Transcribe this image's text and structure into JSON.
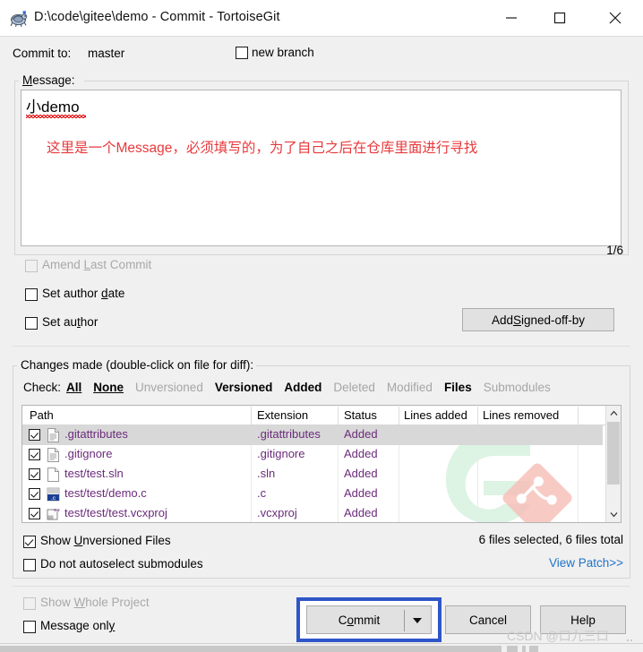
{
  "window": {
    "title": "D:\\code\\gitee\\demo - Commit - TortoiseGit",
    "icon": "tortoisegit-turtle-icon",
    "minimize": "—",
    "maximize": "□",
    "close": "✕"
  },
  "commit_to": {
    "label": "Commit to:",
    "value": "master",
    "new_branch_label": "new branch",
    "new_branch_checked": false
  },
  "message": {
    "group_title": "Message:",
    "line1": "小demo",
    "line2": "这里是一个Message，必须填写的，为了自己之后在仓库里面进行寻找",
    "line1_color": "#000000",
    "line2_color": "#e8393c",
    "counter": "1/6"
  },
  "options_upper": [
    {
      "id": "amend-last-commit",
      "label": "Amend Last Commit",
      "checked": false,
      "disabled": true
    },
    {
      "id": "set-author-date",
      "label": "Set author date",
      "checked": false,
      "disabled": false
    },
    {
      "id": "set-author",
      "label": "Set author",
      "checked": false,
      "disabled": false
    }
  ],
  "add_signed_off_button": "Add Signed-off-by",
  "changes": {
    "group_title": "Changes made (double-click on file for diff):",
    "check_label": "Check:",
    "check_links": [
      {
        "label": "All",
        "state": "link"
      },
      {
        "label": "None",
        "state": "link"
      },
      {
        "label": "Unversioned",
        "state": "off"
      },
      {
        "label": "Versioned",
        "state": "on"
      },
      {
        "label": "Added",
        "state": "on"
      },
      {
        "label": "Deleted",
        "state": "off"
      },
      {
        "label": "Modified",
        "state": "off"
      },
      {
        "label": "Files",
        "state": "on"
      },
      {
        "label": "Submodules",
        "state": "off"
      }
    ],
    "columns": [
      "Path",
      "Extension",
      "Status",
      "Lines added",
      "Lines removed"
    ],
    "rows": [
      {
        "checked": true,
        "icon": "text-file-icon",
        "path": ".gitattributes",
        "extension": ".gitattributes",
        "status": "Added",
        "lines_added": "",
        "lines_removed": "",
        "selected": true
      },
      {
        "checked": true,
        "icon": "text-file-icon",
        "path": ".gitignore",
        "extension": ".gitignore",
        "status": "Added",
        "lines_added": "",
        "lines_removed": "",
        "selected": false
      },
      {
        "checked": true,
        "icon": "blank-file-icon",
        "path": "test/test.sln",
        "extension": ".sln",
        "status": "Added",
        "lines_added": "",
        "lines_removed": "",
        "selected": false
      },
      {
        "checked": true,
        "icon": "c-source-icon",
        "path": "test/test/demo.c",
        "extension": ".c",
        "status": "Added",
        "lines_added": "",
        "lines_removed": "",
        "selected": false
      },
      {
        "checked": true,
        "icon": "vcxproj-icon",
        "path": "test/test/test.vcxproj",
        "extension": ".vcxproj",
        "status": "Added",
        "lines_added": "",
        "lines_removed": "",
        "selected": false
      }
    ],
    "files_total": "6 files selected, 6 files total",
    "view_patch": "View Patch>>"
  },
  "options_lower": [
    {
      "id": "show-unversioned-files",
      "label": "Show Unversioned Files",
      "checked": true,
      "disabled": false
    },
    {
      "id": "do-not-autoselect-submodules",
      "label": "Do not autoselect submodules",
      "checked": false,
      "disabled": false
    },
    {
      "id": "show-whole-project",
      "label": "Show Whole Project",
      "checked": false,
      "disabled": true
    },
    {
      "id": "message-only",
      "label": "Message only",
      "checked": false,
      "disabled": false
    }
  ],
  "buttons": {
    "commit": "Commit",
    "commit_has_dropdown": true,
    "cancel": "Cancel",
    "help": "Help"
  },
  "annotation": {
    "highlight_color": "#2f56c8",
    "highlight_target": "commit-button"
  },
  "watermark": {
    "text": "CSDN @口九三口",
    "logo": "gitee-logo-watermark"
  }
}
